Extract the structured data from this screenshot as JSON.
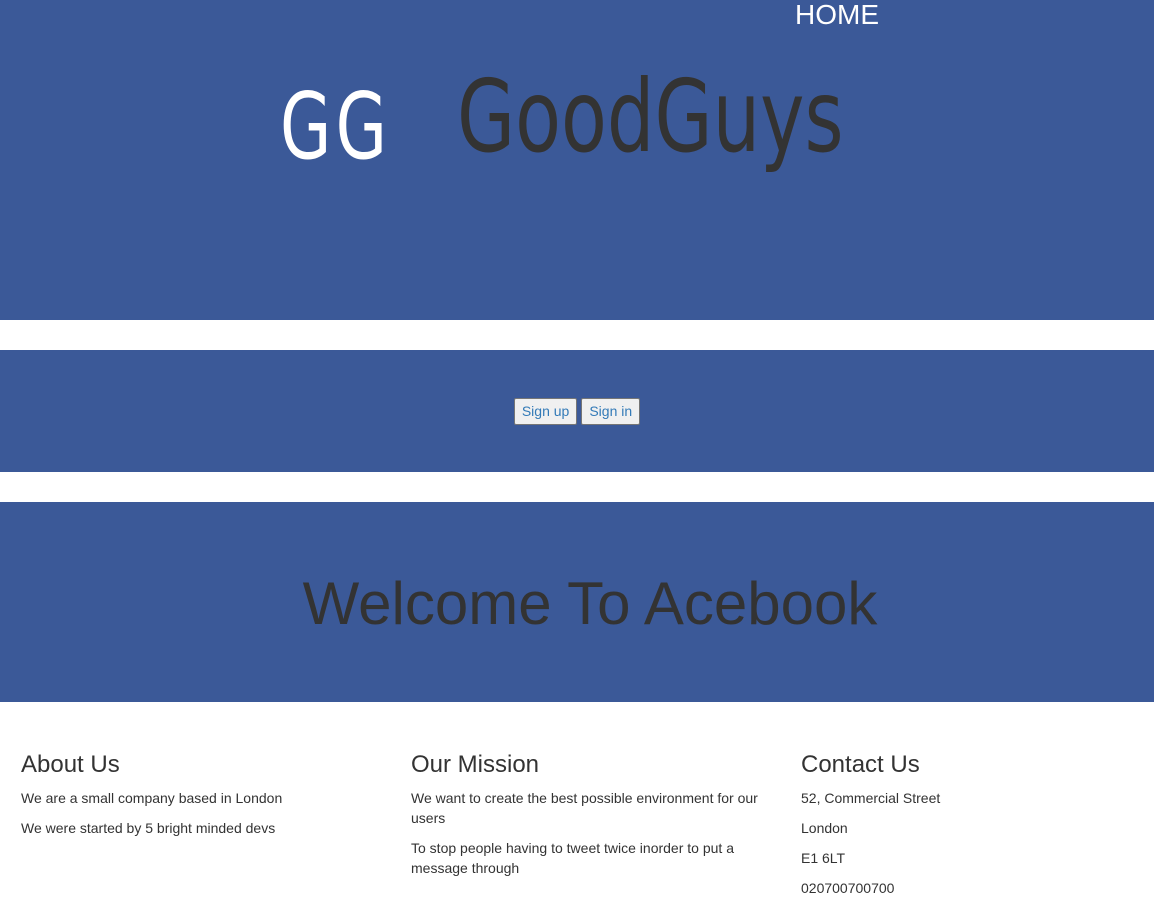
{
  "header": {
    "nav_home": "HOME",
    "logo_mark": "GG",
    "logo_name": "GoodGuys"
  },
  "auth": {
    "signup_label": "Sign up",
    "signin_label": "Sign in"
  },
  "welcome": {
    "title": "Welcome To Acebook"
  },
  "footer": {
    "about": {
      "heading": "About Us",
      "lines": [
        "We are a small company based in London",
        "We were started by 5 bright minded devs"
      ]
    },
    "mission": {
      "heading": "Our Mission",
      "lines": [
        "We want to create the best possible environment for our users",
        "To stop people having to tweet twice inorder to put a message through"
      ]
    },
    "contact": {
      "heading": "Contact Us",
      "lines": [
        "52, Commercial Street",
        "London",
        "E1 6LT",
        "020700700700"
      ]
    }
  },
  "colors": {
    "brand_blue": "#3b5998",
    "dark_text": "#333333",
    "link_blue": "#337ab7"
  }
}
